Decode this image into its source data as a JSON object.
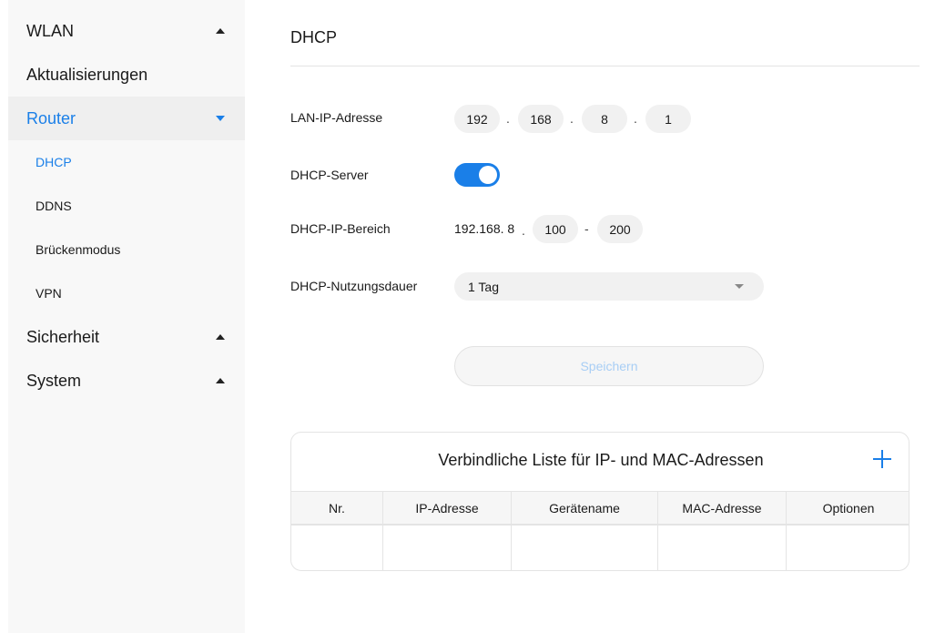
{
  "sidebar": {
    "wlan": "WLAN",
    "updates": "Aktualisierungen",
    "router": "Router",
    "router_items": [
      "DHCP",
      "DDNS",
      "Brückenmodus",
      "VPN"
    ],
    "security": "Sicherheit",
    "system": "System"
  },
  "main": {
    "title": "DHCP",
    "lan_ip_label": "LAN-IP-Adresse",
    "lan_ip": [
      "192",
      "168",
      "8",
      "1"
    ],
    "dhcp_server_label": "DHCP-Server",
    "dhcp_server_enabled": true,
    "range_label": "DHCP-IP-Bereich",
    "range_prefix": "192.168. 8",
    "range_start": "100",
    "range_end": "200",
    "range_separator": "-",
    "ip_separator": ".",
    "lease_label": "DHCP-Nutzungsdauer",
    "lease_value": "1 Tag",
    "save_label": "Speichern"
  },
  "binding_list": {
    "title": "Verbindliche Liste für IP- und MAC-Adressen",
    "columns": [
      "Nr.",
      "IP-Adresse",
      "Gerätename",
      "MAC-Adresse",
      "Optionen"
    ]
  },
  "colors": {
    "accent": "#1a7fe8",
    "sidebar_bg": "#f8f8f8",
    "input_bg": "#f1f1f1"
  }
}
